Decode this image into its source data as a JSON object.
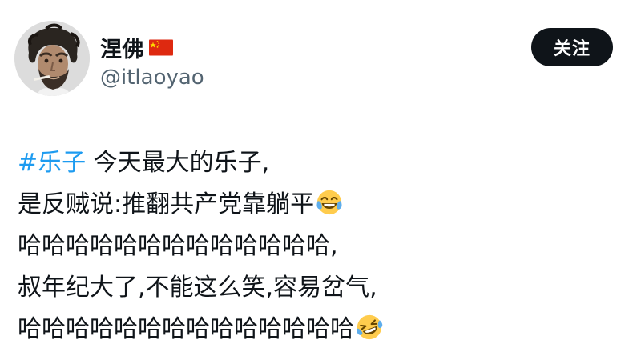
{
  "author": {
    "display_name": "涅佛",
    "flag_icon": "china-flag-icon",
    "handle": "@itlaoyao",
    "avatar_icon": "profile-photo"
  },
  "follow_button": {
    "label": "关注",
    "background": "#0f1419",
    "text_color": "#ffffff"
  },
  "tweet": {
    "hashtag": "#乐子",
    "line1_rest": " 今天最大的乐子,",
    "line2": "是反贼说:推翻共产党靠躺平",
    "line2_emoji": "face-with-tears-of-joy-icon",
    "line3": "哈哈哈哈哈哈哈哈哈哈哈哈哈,",
    "line4": "叔年纪大了,不能这么笑,容易岔气,",
    "line5": "哈哈哈哈哈哈哈哈哈哈哈哈哈哈",
    "line5_emoji": "rolling-on-floor-laughing-icon"
  },
  "colors": {
    "text": "#0f1419",
    "secondary_text": "#536471",
    "link": "#1d9bf0"
  }
}
